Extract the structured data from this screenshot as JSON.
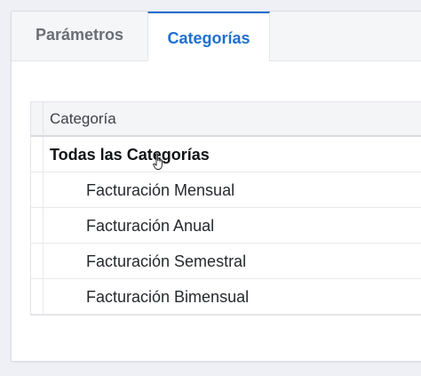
{
  "tabs": [
    {
      "label": "Parámetros",
      "active": false
    },
    {
      "label": "Categorías",
      "active": true
    }
  ],
  "grid": {
    "column_header": "Categoría",
    "rows": [
      {
        "label": "Todas las Categorías",
        "level": 0
      },
      {
        "label": "Facturación Mensual",
        "level": 1
      },
      {
        "label": "Facturación Anual",
        "level": 1
      },
      {
        "label": "Facturación Semestral",
        "level": 1
      },
      {
        "label": "Facturación Bimensual",
        "level": 1
      }
    ]
  },
  "colors": {
    "accent": "#1f6fd0",
    "inactive_tab_text": "#6a6e75",
    "header_bg": "#f4f5f7"
  },
  "icons": {
    "cursor": "hand-pointer-icon"
  }
}
